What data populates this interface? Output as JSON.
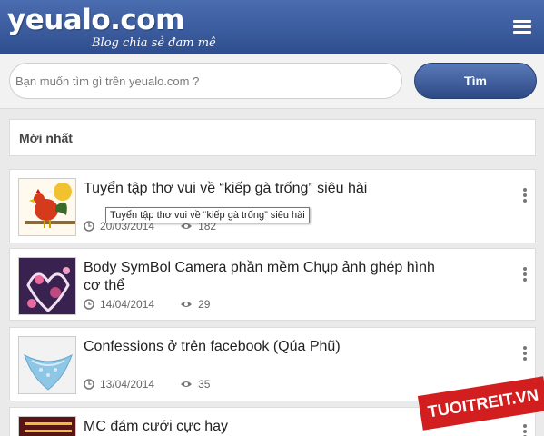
{
  "header": {
    "logo_text": "yeualo.com",
    "tagline": "Blog chia sẻ đam mê"
  },
  "search": {
    "placeholder": "Bạn muốn tìm gì trên yeualo.com ?",
    "button_label": "Tìm"
  },
  "section": {
    "title": "Mới nhất"
  },
  "articles": [
    {
      "title": "Tuyển tập thơ vui về “kiếp gà trống” siêu hài",
      "date": "20/03/2014",
      "views": "182",
      "thumb": "rooster"
    },
    {
      "title": "Body SymBol Camera phần mềm Chụp ảnh ghép hình cơ thể",
      "date": "14/04/2014",
      "views": "29",
      "thumb": "body-art"
    },
    {
      "title": "Confessions ở trên facebook (Qúa Phũ)",
      "date": "13/04/2014",
      "views": "35",
      "thumb": "lace"
    },
    {
      "title": "MC đám cưới cực hay",
      "date": "",
      "views": "",
      "thumb": "mc-book"
    }
  ],
  "tooltip": {
    "text": "Tuyển tập thơ vui về “kiếp gà trống” siêu hài"
  },
  "watermark": {
    "text": "TUOITREIT.VN"
  },
  "icons": {
    "menu": "hamburger-icon",
    "clock": "clock-icon",
    "eye": "eye-icon",
    "more": "more-vertical-icon"
  },
  "colors": {
    "header": "#3a5b9e",
    "button": "#3d5c99",
    "watermark": "#d21e1e"
  }
}
